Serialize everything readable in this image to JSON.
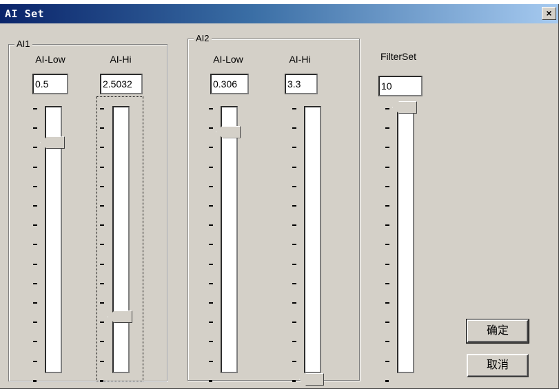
{
  "window": {
    "title": "AI Set",
    "close_glyph": "×"
  },
  "ai1": {
    "label": "AI1",
    "low": {
      "label": "AI-Low",
      "value": "0.5",
      "slider_level": 0.87
    },
    "high": {
      "label": "AI-Hi",
      "value": "2.5032",
      "slider_level": 0.23
    }
  },
  "ai2": {
    "label": "AI2",
    "low": {
      "label": "AI-Low",
      "value": "0.306",
      "slider_level": 0.91
    },
    "high": {
      "label": "AI-Hi",
      "value": "3.3",
      "slider_level": 0.0
    }
  },
  "filter": {
    "label": "FilterSet",
    "value": "10",
    "slider_level": 1.0
  },
  "buttons": {
    "ok": "确定",
    "cancel": "取消"
  },
  "colors": {
    "dialog_bg": "#d4d0c8",
    "titlebar_start": "#0a246a",
    "titlebar_end": "#a6caf0"
  }
}
